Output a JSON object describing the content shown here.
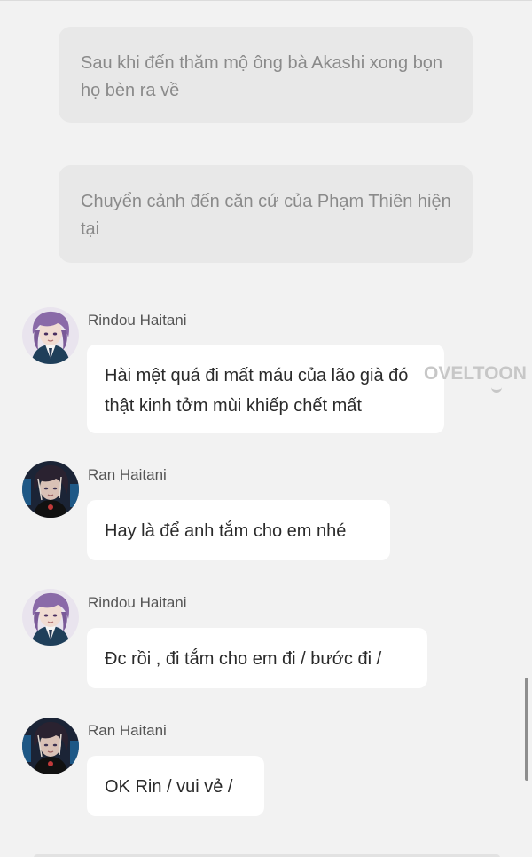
{
  "narrations": [
    "Sau khi đến thăm mộ ông bà Akashi xong bọn họ bèn ra về",
    "Chuyển cảnh đến căn cứ của Phạm Thiên hiện tại"
  ],
  "messages": [
    {
      "sender": "Rindou Haitani",
      "text": "Hài  mệt quá đi mất máu của  lão già đó thật kinh tởm mùi khiếp chết mất",
      "avatar": "rindou-avatar"
    },
    {
      "sender": "Ran Haitani",
      "text": "Hay là để anh tắm cho em nhé",
      "avatar": "ran-avatar"
    },
    {
      "sender": "Rindou Haitani",
      "text": "Đc rồi , đi tắm cho em đi / bước đi /",
      "avatar": "rindou-avatar"
    },
    {
      "sender": "Ran Haitani",
      "text": "OK Rin / vui vẻ /",
      "avatar": "ran-avatar"
    }
  ],
  "watermark": "OVELTOON",
  "colors": {
    "background": "#f2f2f2",
    "narration_bg": "#e8e8e8",
    "bubble_bg": "#ffffff",
    "rindou_hair": "#8a6aa8",
    "ran_hair": "#2a2230"
  }
}
